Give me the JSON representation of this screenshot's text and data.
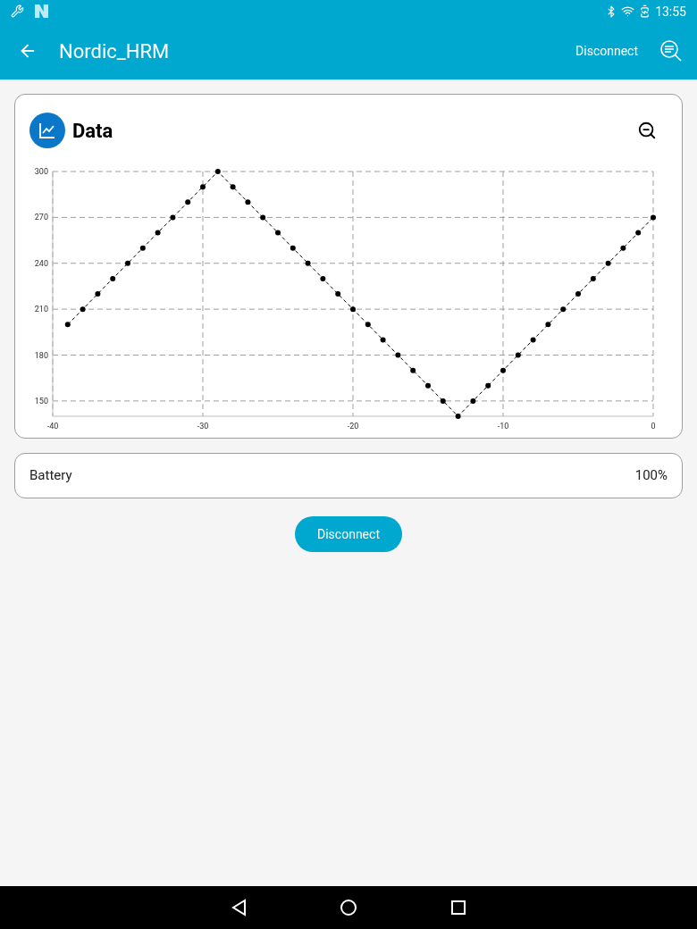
{
  "status_bar": {
    "time": "13:55"
  },
  "app_bar": {
    "title": "Nordic_HRM",
    "action": "Disconnect"
  },
  "data_card": {
    "title": "Data",
    "chart_data": {
      "type": "line",
      "x": [
        -39,
        -38,
        -37,
        -36,
        -35,
        -34,
        -33,
        -32,
        -31,
        -30,
        -29,
        -28,
        -27,
        -26,
        -25,
        -24,
        -23,
        -22,
        -21,
        -20,
        -19,
        -18,
        -17,
        -16,
        -15,
        -14,
        -13,
        -12,
        -11,
        -10,
        -9,
        -8,
        -7,
        -6,
        -5,
        -4,
        -3,
        -2,
        -1,
        0
      ],
      "grid": true,
      "series": [
        {
          "color": "#000000",
          "line_style": "dashed",
          "marker": "circle",
          "values": [
            200,
            210,
            220,
            230,
            240,
            250,
            260,
            270,
            280,
            290,
            300,
            290,
            280,
            270,
            260,
            250,
            240,
            230,
            220,
            210,
            200,
            190,
            180,
            170,
            160,
            150,
            140,
            150,
            160,
            170,
            180,
            190,
            200,
            210,
            220,
            230,
            240,
            250,
            260,
            270
          ]
        }
      ],
      "xlim": [
        -40,
        0
      ],
      "ylim": [
        140,
        300
      ],
      "xticks": [
        -40,
        -30,
        -20,
        -10,
        0
      ],
      "yticks": [
        150,
        180,
        210,
        240,
        270,
        300
      ]
    }
  },
  "battery": {
    "label": "Battery",
    "value": "100%"
  },
  "button": "Disconnect"
}
